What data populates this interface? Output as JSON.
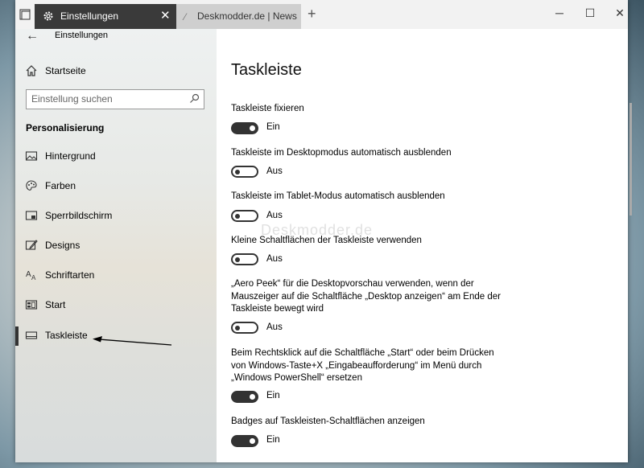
{
  "titlebar": {
    "active_tab": "Einstellungen",
    "inactive_tab": "Deskmodder.de | News, Tip",
    "new_tab": "+",
    "minimize": "─",
    "maximize": "☐",
    "close": "✕",
    "tab_close": "✕"
  },
  "nav": {
    "back": "←",
    "breadcrumb": "Einstellungen",
    "home": "Startseite",
    "search_placeholder": "Einstellung suchen",
    "section": "Personalisierung",
    "items": [
      {
        "label": "Hintergrund",
        "icon": "picture-icon"
      },
      {
        "label": "Farben",
        "icon": "palette-icon"
      },
      {
        "label": "Sperrbildschirm",
        "icon": "lockscreen-icon"
      },
      {
        "label": "Designs",
        "icon": "brush-icon"
      },
      {
        "label": "Schriftarten",
        "icon": "font-icon"
      },
      {
        "label": "Start",
        "icon": "start-icon"
      },
      {
        "label": "Taskleiste",
        "icon": "taskbar-icon",
        "selected": true
      }
    ]
  },
  "main": {
    "title": "Taskleiste",
    "watermark": "Deskmodder.de",
    "settings": [
      {
        "label": "Taskleiste fixieren",
        "on": true,
        "state": "Ein"
      },
      {
        "label": "Taskleiste im Desktopmodus automatisch ausblenden",
        "on": false,
        "state": "Aus"
      },
      {
        "label": "Taskleiste im Tablet-Modus automatisch ausblenden",
        "on": false,
        "state": "Aus"
      },
      {
        "label": "Kleine Schaltflächen der Taskleiste verwenden",
        "on": false,
        "state": "Aus"
      },
      {
        "label": "„Aero Peek“ für die Desktopvorschau verwenden, wenn der Mauszeiger auf die Schaltfläche „Desktop anzeigen“ am Ende der Taskleiste bewegt wird",
        "on": false,
        "state": "Aus"
      },
      {
        "label": "Beim Rechtsklick auf die Schaltfläche „Start“ oder beim Drücken von Windows-Taste+X „Eingabeaufforderung“ im Menü durch „Windows PowerShell“ ersetzen",
        "on": true,
        "state": "Ein"
      },
      {
        "label": "Badges auf Taskleisten-Schaltflächen anzeigen",
        "on": true,
        "state": "Ein"
      }
    ]
  },
  "colors": {
    "titlebar_active": "#3a3a3a",
    "toggle_on": "#333333",
    "accent": "#000000"
  }
}
